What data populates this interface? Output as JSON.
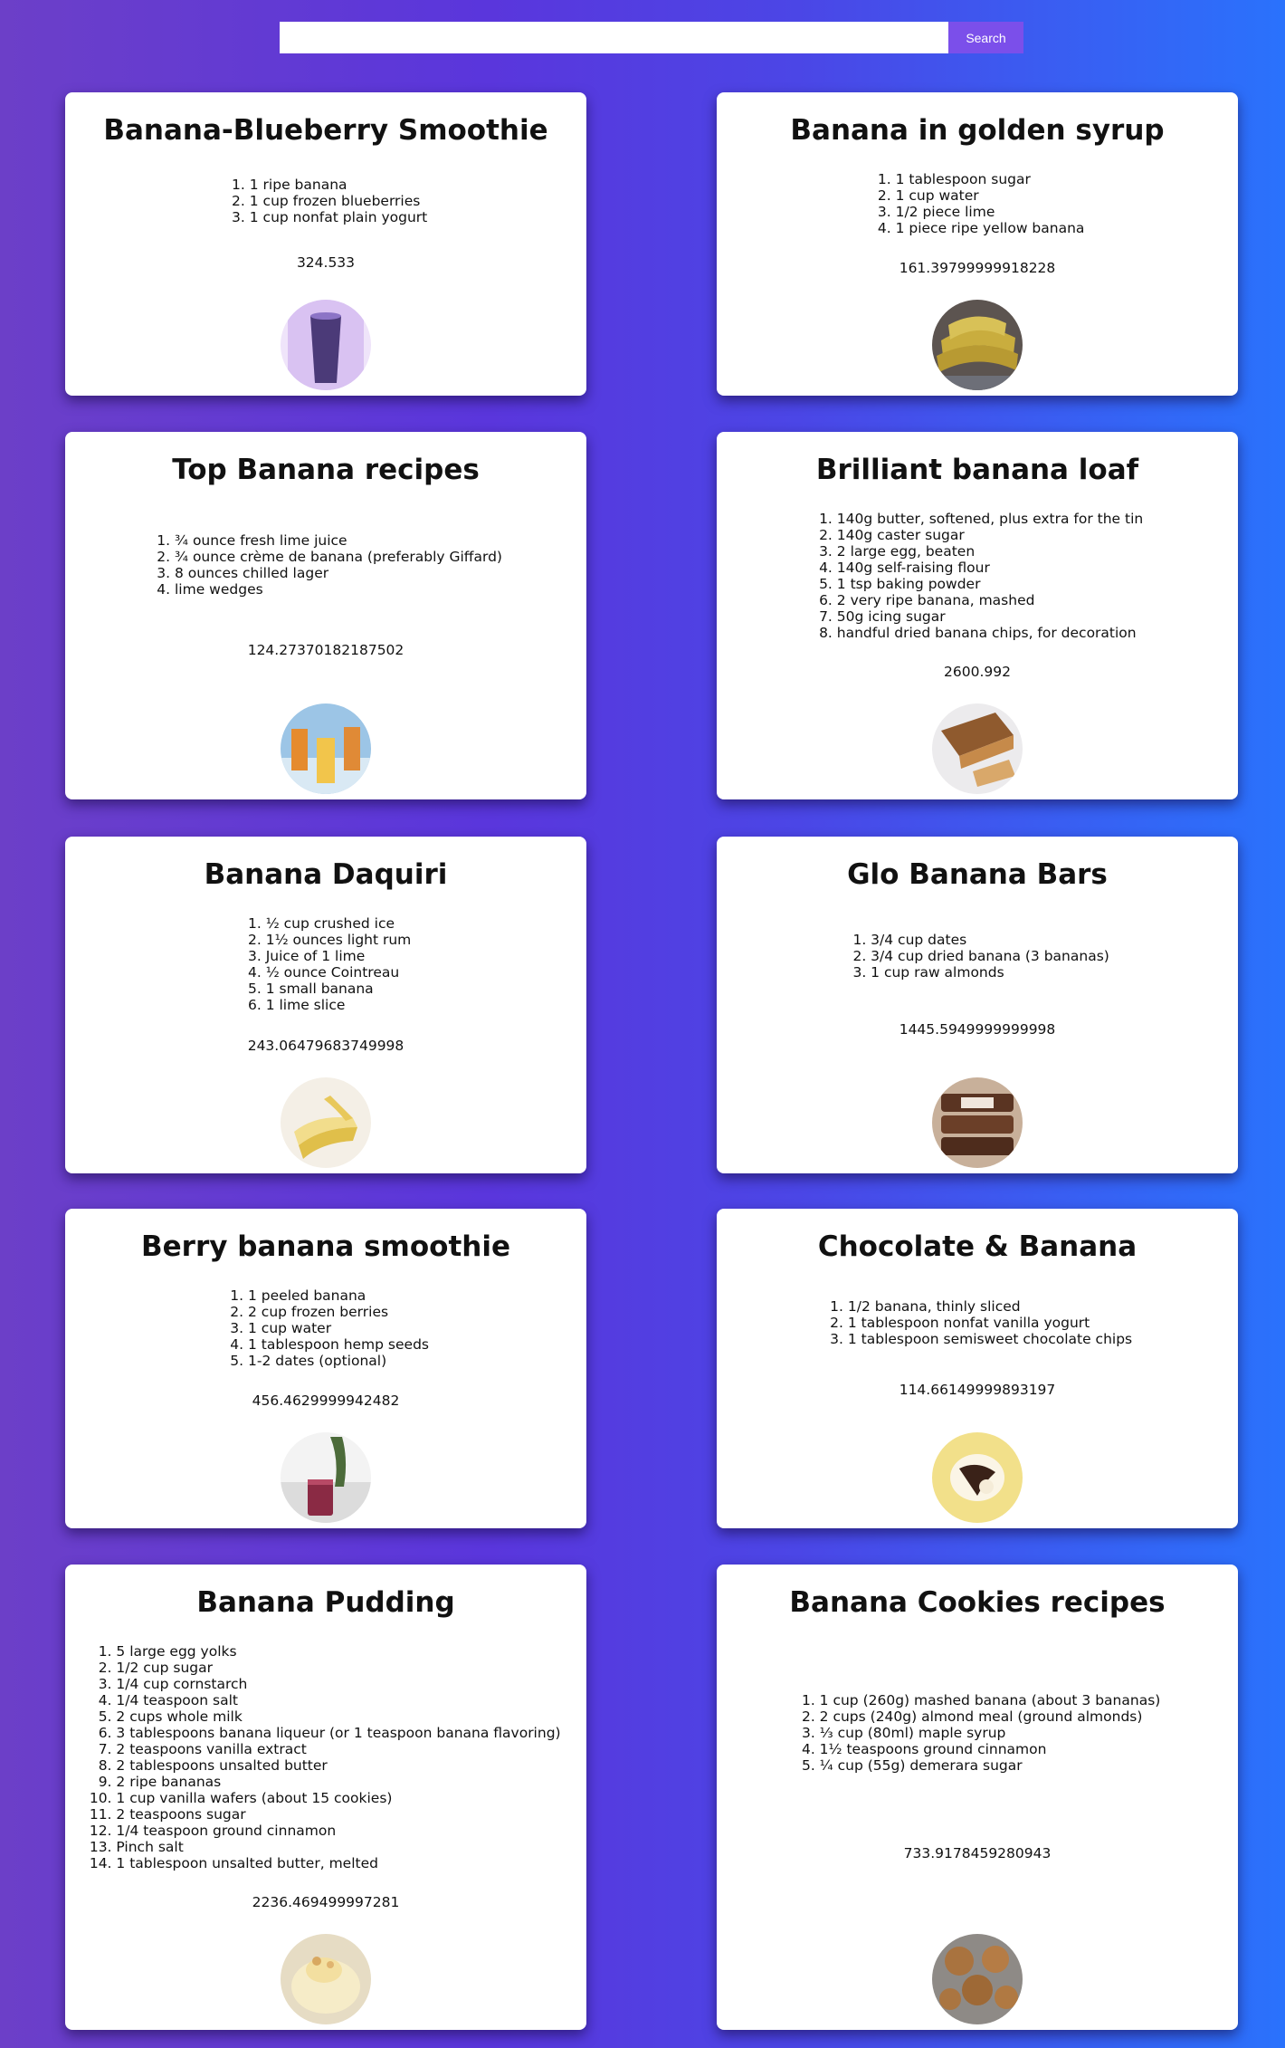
{
  "search": {
    "placeholder": "",
    "button_label": "Search"
  },
  "recipes": [
    {
      "title": "Banana-Blueberry Smoothie",
      "ingredients": [
        "1 ripe banana",
        "1 cup frozen blueberries",
        "1 cup nonfat plain yogurt"
      ],
      "calories": "324.533",
      "image_icon": "blueberry-smoothie-image"
    },
    {
      "title": "Banana in golden syrup",
      "ingredients": [
        "1 tablespoon sugar",
        "1 cup water",
        "1/2 piece lime",
        "1 piece ripe yellow banana"
      ],
      "calories": "161.39799999918228",
      "image_icon": "bananas-basket-image"
    },
    {
      "title": "Top Banana recipes",
      "ingredients": [
        "¾ ounce fresh lime juice",
        "¾ ounce crème de banana (preferably Giffard)",
        "8 ounces chilled lager",
        "lime wedges"
      ],
      "calories": "124.27370182187502",
      "image_icon": "banana-cocktail-image"
    },
    {
      "title": "Brilliant banana loaf",
      "ingredients": [
        "140g butter, softened, plus extra for the tin",
        "140g caster sugar",
        "2 large egg, beaten",
        "140g self-raising flour",
        "1 tsp baking powder",
        "2 very ripe banana, mashed",
        "50g icing sugar",
        "handful dried banana chips, for decoration"
      ],
      "calories": "2600.992",
      "image_icon": "banana-loaf-image"
    },
    {
      "title": "Banana Daquiri",
      "ingredients": [
        "½ cup crushed ice",
        "1½ ounces light rum",
        "Juice of 1 lime",
        "½ ounce Cointreau",
        "1 small banana",
        "1 lime slice"
      ],
      "calories": "243.06479683749998",
      "image_icon": "peeled-banana-image"
    },
    {
      "title": "Glo Banana Bars",
      "ingredients": [
        "3/4 cup dates",
        "3/4 cup dried banana (3 bananas)",
        "1 cup raw almonds"
      ],
      "calories": "1445.5949999999998",
      "image_icon": "banana-bars-image"
    },
    {
      "title": "Berry banana smoothie",
      "ingredients": [
        "1 peeled banana",
        "2 cup frozen berries",
        "1 cup water",
        "1 tablespoon hemp seeds",
        "1-2 dates (optional)"
      ],
      "calories": "456.4629999942482",
      "image_icon": "berry-smoothie-image"
    },
    {
      "title": "Chocolate & Banana",
      "ingredients": [
        "1/2 banana, thinly sliced",
        "1 tablespoon nonfat vanilla yogurt",
        "1 tablespoon semisweet chocolate chips"
      ],
      "calories": "114.66149999893197",
      "image_icon": "chocolate-banana-image"
    },
    {
      "title": "Banana Pudding",
      "ingredients": [
        "5 large egg yolks",
        "1/2 cup sugar",
        "1/4 cup cornstarch",
        "1/4 teaspoon salt",
        "2 cups whole milk",
        "3 tablespoons banana liqueur (or 1 teaspoon banana flavoring)",
        "2 teaspoons vanilla extract",
        "2 tablespoons unsalted butter",
        "2 ripe bananas",
        "1 cup vanilla wafers (about 15 cookies)",
        "2 teaspoons sugar",
        "1/4 teaspoon ground cinnamon",
        "Pinch salt",
        "1 tablespoon unsalted butter, melted"
      ],
      "calories": "2236.469499997281",
      "image_icon": "banana-pudding-image"
    },
    {
      "title": "Banana Cookies recipes",
      "ingredients": [
        "1 cup (260g) mashed banana (about 3 bananas)",
        "2 cups (240g) almond meal (ground almonds)",
        "⅓ cup (80ml) maple syrup",
        "1½ teaspoons ground cinnamon",
        "¼ cup (55g) demerara sugar"
      ],
      "calories": "733.9178459280943",
      "image_icon": "banana-cookies-image"
    }
  ]
}
